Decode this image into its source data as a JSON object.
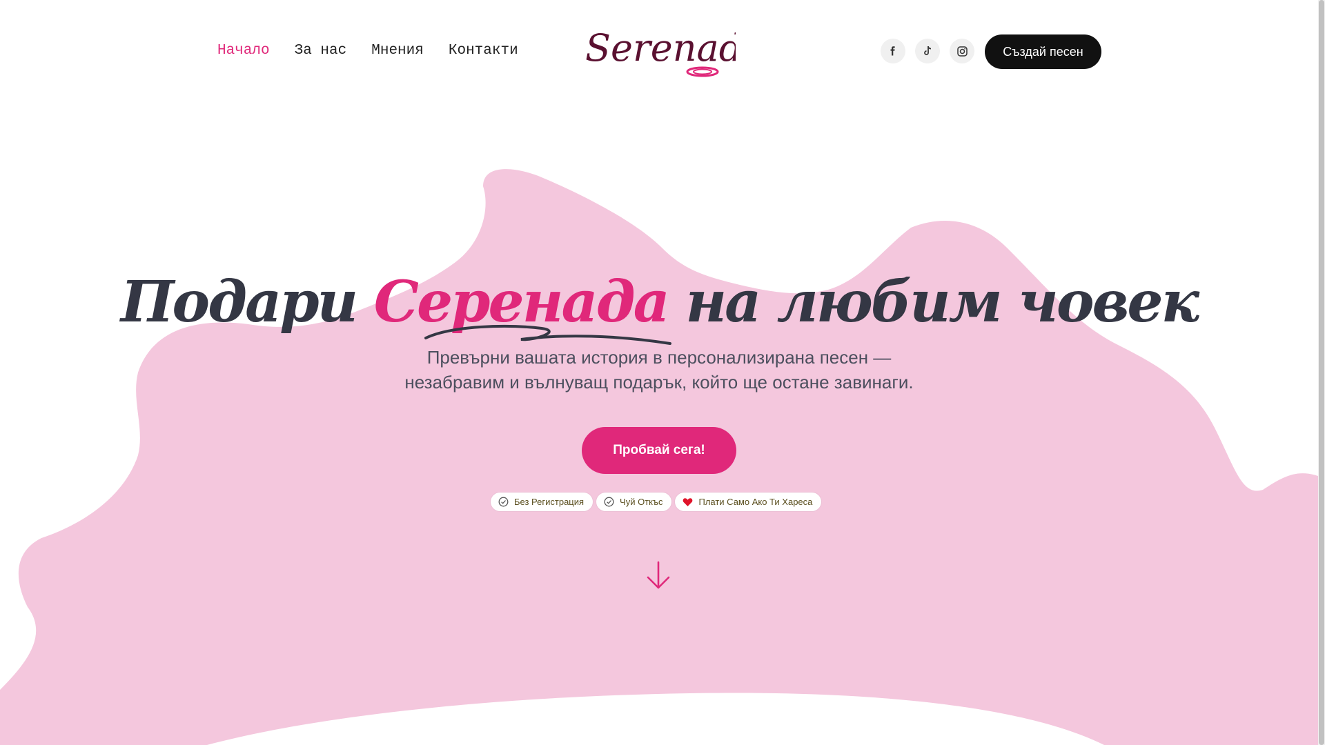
{
  "header": {
    "nav": [
      {
        "label": "Начало",
        "active": true
      },
      {
        "label": "За нас",
        "active": false
      },
      {
        "label": "Мнения",
        "active": false
      },
      {
        "label": "Контакти",
        "active": false
      }
    ],
    "logo_text": "Serenada",
    "socials": [
      "facebook-icon",
      "tiktok-icon",
      "instagram-icon"
    ],
    "cta_label": "Създай песен"
  },
  "hero": {
    "title_before": "Подари",
    "title_accent": "Серенада",
    "title_after": "на любим човек",
    "subtitle_line1": "Превърни вашата история в персонализирана песен —",
    "subtitle_line2": "незабравим и вълнуващ подарък, който ще остане завинаги.",
    "cta_label": "Пробвай сега!",
    "badges": [
      {
        "icon": "check-circle-icon",
        "label": "Без Регистрация"
      },
      {
        "icon": "check-circle-icon",
        "label": "Чуй Откъс"
      },
      {
        "icon": "heart-icon",
        "label": "Плати Само Ако Ти Хареса"
      }
    ],
    "scroll_icon": "arrow-down-icon"
  },
  "colors": {
    "accent": "#e0287a",
    "blob": "#f4c7dd",
    "text_dark": "#343744",
    "logo_dark": "#5a1030"
  }
}
